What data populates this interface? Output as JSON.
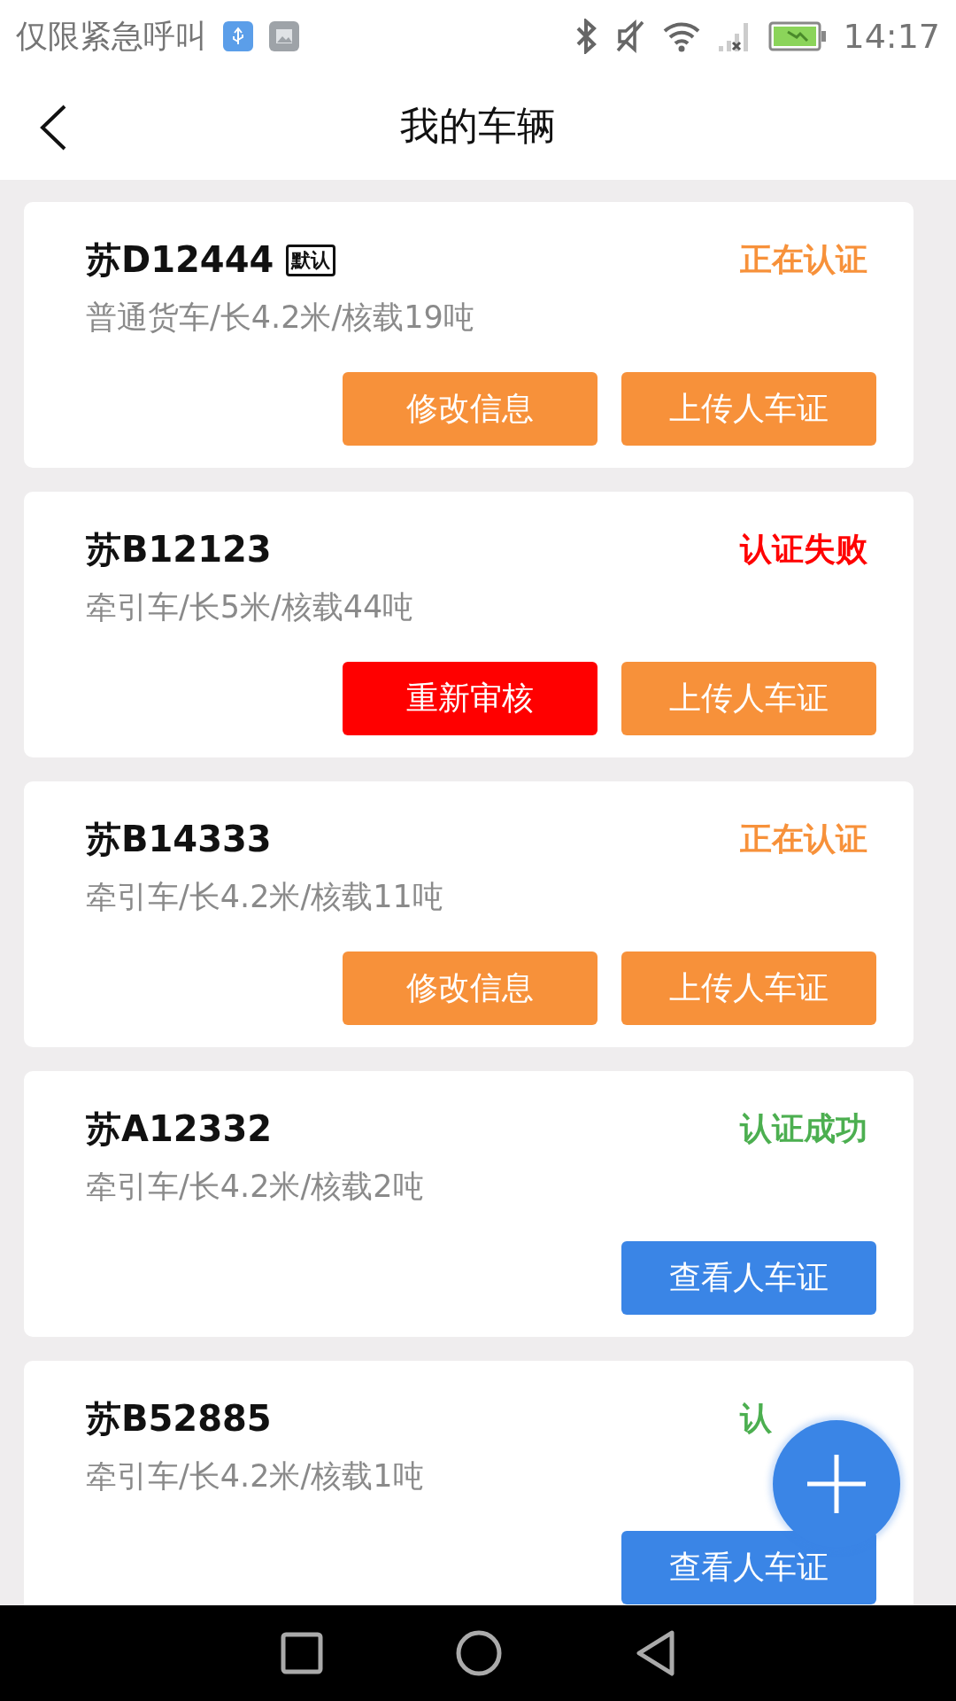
{
  "status_bar": {
    "carrier": "仅限紧急呼叫",
    "time": "14:17"
  },
  "header": {
    "title": "我的车辆"
  },
  "vehicles": [
    {
      "plate": "苏D12444",
      "badge": "默认",
      "specs": "普通货车/长4.2米/核载19吨",
      "status": "正在认证",
      "color": "#f7913a",
      "buttons": [
        {
          "label": "修改信息",
          "color": "#f7913a"
        },
        {
          "label": "上传人车证",
          "color": "#f7913a"
        }
      ]
    },
    {
      "plate": "苏B12123",
      "specs": "牵引车/长5米/核载44吨",
      "status": "认证失败",
      "color": "#ff0000",
      "buttons": [
        {
          "label": "重新审核",
          "color": "#ff0000"
        },
        {
          "label": "上传人车证",
          "color": "#f7913a"
        }
      ]
    },
    {
      "plate": "苏B14333",
      "specs": "牵引车/长4.2米/核载11吨",
      "status": "正在认证",
      "color": "#f7913a",
      "buttons": [
        {
          "label": "修改信息",
          "color": "#f7913a"
        },
        {
          "label": "上传人车证",
          "color": "#f7913a"
        }
      ]
    },
    {
      "plate": "苏A12332",
      "specs": "牵引车/长4.2米/核载2吨",
      "status": "认证成功",
      "color": "#4caf50",
      "buttons": [
        {
          "label": "查看人车证",
          "color": "#3a85e6"
        }
      ]
    },
    {
      "plate": "苏B52885",
      "specs": "牵引车/长4.2米/核载1吨",
      "status": "认",
      "color": "#4caf50",
      "buttons": [
        {
          "label": "查看人车证",
          "color": "#3a85e6"
        }
      ]
    }
  ]
}
